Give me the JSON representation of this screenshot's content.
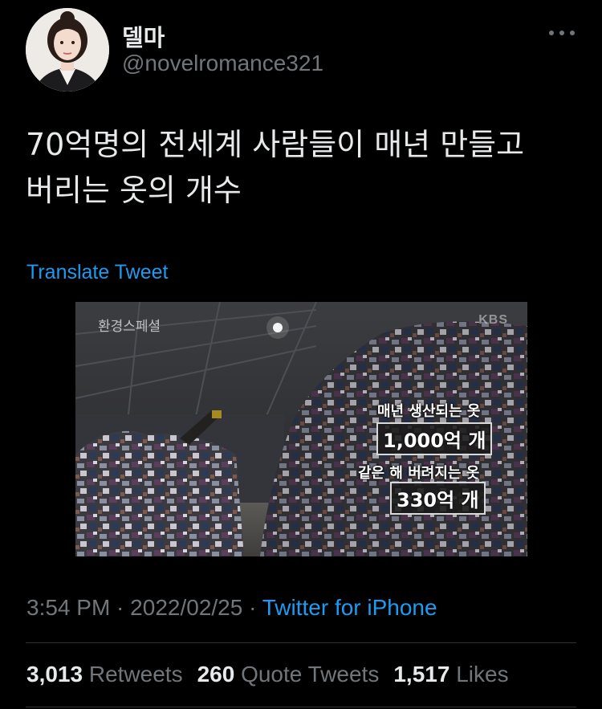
{
  "author": {
    "display_name": "델마",
    "handle": "@novelromance321"
  },
  "tweet": {
    "text_lines": [
      "70억명의 전세계 사람들이 매년 만들고",
      "버리는 옷의 개수"
    ],
    "translate_label": "Translate Tweet"
  },
  "media": {
    "tag": "환경스페셜",
    "logo": "KBS",
    "caption_1": "매년 생산되는 옷",
    "value_1": "1,000억 개",
    "caption_2": "같은 해 버려지는 옷",
    "value_2": "330억 개"
  },
  "meta": {
    "time": "3:54 PM",
    "date": "2022/02/25",
    "separator": " · ",
    "source": "Twitter for iPhone"
  },
  "stats": {
    "retweets": "3,013",
    "retweets_label": "Retweets",
    "quotes": "260",
    "quotes_label": "Quote Tweets",
    "likes": "1,517",
    "likes_label": "Likes"
  },
  "colors": {
    "background": "#000000",
    "text": "#e7e9ea",
    "muted": "#71767b",
    "link": "#1d9bf0",
    "divider": "#2f3336"
  },
  "icons": {
    "more": "more-horizontal-icon"
  }
}
